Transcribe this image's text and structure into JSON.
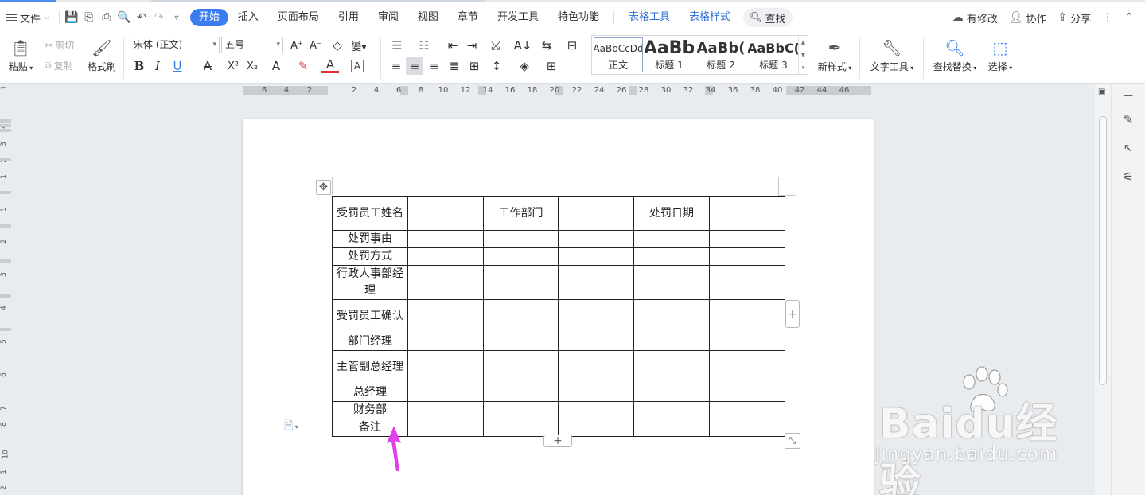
{
  "menubar": {
    "file_label": "文件",
    "tabs": [
      "开始",
      "插入",
      "页面布局",
      "引用",
      "审阅",
      "视图",
      "章节",
      "开发工具",
      "特色功能"
    ],
    "active_tab": "开始",
    "context_tabs": [
      "表格工具",
      "表格样式"
    ],
    "search_label": "查找",
    "right": {
      "modified": "有修改",
      "collab": "协作",
      "share": "分享"
    }
  },
  "ribbon": {
    "paste": "粘贴",
    "cut": "剪切",
    "copy": "复制",
    "format_painter": "格式刷",
    "font_name": "宋体 (正文)",
    "font_size": "五号",
    "styles": [
      {
        "preview": "AaBbCcDd",
        "label": "正文"
      },
      {
        "preview": "AaBb",
        "label": "标题 1"
      },
      {
        "preview": "AaBb(",
        "label": "标题 2"
      },
      {
        "preview": "AaBbC(",
        "label": "标题 3"
      }
    ],
    "new_style": "新样式",
    "text_tools": "文字工具",
    "find_replace": "查找替换",
    "select": "选择"
  },
  "ruler": {
    "h_left": [
      "6",
      "4",
      "2"
    ],
    "h_right": [
      "2",
      "4",
      "6",
      "8",
      "10",
      "12",
      "14",
      "16",
      "18",
      "20",
      "22",
      "24",
      "26",
      "28",
      "30",
      "32",
      "34",
      "36",
      "38",
      "40",
      "42",
      "44",
      "46"
    ],
    "v": [
      "4",
      "3",
      "2",
      "1",
      "1",
      "2",
      "3",
      "4",
      "5",
      "6",
      "7",
      "8",
      "10",
      "1",
      "2",
      "3",
      "14",
      "15",
      "16",
      "18"
    ]
  },
  "table": {
    "rows": [
      [
        "受罚员工姓名",
        "",
        "工作部门",
        "",
        "处罚日期",
        ""
      ],
      [
        "处罚事由",
        "",
        "",
        "",
        "",
        ""
      ],
      [
        "处罚方式",
        "",
        "",
        "",
        "",
        ""
      ],
      [
        "行政人事部经理",
        "",
        "",
        "",
        "",
        ""
      ],
      [
        "受罚员工确认",
        "",
        "",
        "",
        "",
        ""
      ],
      [
        "部门经理",
        "",
        "",
        "",
        "",
        ""
      ],
      [
        "主管副总经理",
        "",
        "",
        "",
        "",
        ""
      ],
      [
        "总经理",
        "",
        "",
        "",
        "",
        ""
      ],
      [
        "财务部",
        "",
        "",
        "",
        "",
        ""
      ],
      [
        "备注",
        "",
        "",
        "",
        "",
        ""
      ]
    ]
  },
  "watermark": {
    "brand": "Baidu经验",
    "url": "jingyan.baidu.com"
  },
  "colors": {
    "accent": "#3b7cf0",
    "context_tab": "#2b6fd6",
    "arrow": "#e040e8"
  }
}
